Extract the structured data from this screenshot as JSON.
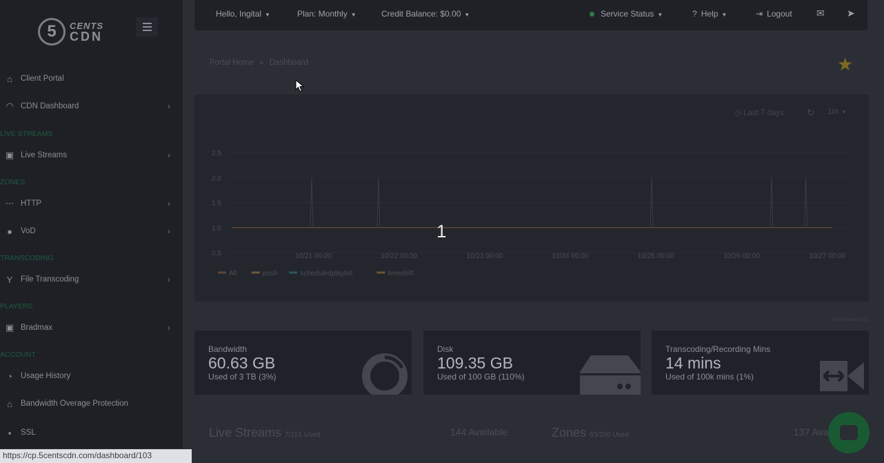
{
  "logo": {
    "mark": "5",
    "top": "CENTS",
    "bottom": "CDN"
  },
  "sidebar": {
    "items": [
      {
        "label": "Client Portal",
        "icon": "home-icon",
        "glyph": "⌂",
        "chevron": false
      },
      {
        "label": "CDN Dashboard",
        "icon": "gauge-icon",
        "glyph": "◠",
        "chevron": true
      },
      {
        "section": "LIVE STREAMS"
      },
      {
        "label": "Live Streams",
        "icon": "video-icon",
        "glyph": "▣",
        "chevron": true
      },
      {
        "section": "ZONES"
      },
      {
        "label": "HTTP",
        "icon": "http-icon",
        "glyph": "⋯",
        "chevron": true
      },
      {
        "label": "VoD",
        "icon": "play-icon",
        "glyph": "●",
        "chevron": true
      },
      {
        "section": "TRANSCODING"
      },
      {
        "label": "File Transcoding",
        "icon": "transcode-icon",
        "glyph": "Y",
        "chevron": true
      },
      {
        "section": "PLAYERS"
      },
      {
        "label": "Bradmax",
        "icon": "player-icon",
        "glyph": "▣",
        "chevron": true
      },
      {
        "section": "ACCOUNT"
      },
      {
        "label": "Usage History",
        "icon": "history-icon",
        "glyph": "◔",
        "chevron": false
      },
      {
        "label": "Bandwidth Overage Protection",
        "icon": "bank-icon",
        "glyph": "⌂",
        "chevron": false
      },
      {
        "label": "SSL",
        "icon": "lock-icon",
        "glyph": "▪",
        "chevron": false
      }
    ]
  },
  "topbar": {
    "greeting": "Hello, Ingital",
    "plan": "Plan: Monthly",
    "credit": "Credit Balance: $0.00",
    "service_status": "Service Status",
    "help": "Help",
    "logout": "Logout"
  },
  "breadcrumb": {
    "home": "Portal Home",
    "sep": "»",
    "current": "Dashboard"
  },
  "chart_controls": {
    "range": "Last 7 days",
    "interval": "1m"
  },
  "chart_data": {
    "type": "line",
    "x": [
      "10/21 00:00",
      "10/22 00:00",
      "10/23 00:00",
      "10/24 00:00",
      "10/25 00:00",
      "10/26 00:00",
      "10/27 00:00"
    ],
    "yticks": [
      0.5,
      1.0,
      1.5,
      2.0,
      2.5
    ],
    "ylim": [
      0.5,
      2.5
    ],
    "baseline": 1.0,
    "spikes_at_day": [
      0.0,
      0.78,
      3.97,
      5.37,
      5.77
    ],
    "spike_value": 2.0,
    "series": [
      {
        "name": "All",
        "color": "#5b4636"
      },
      {
        "name": "push",
        "color": "#6b5a3e"
      },
      {
        "name": "scheduledplaylist",
        "color": "#2f5560"
      },
      {
        "name": "timeshift",
        "color": "#6a5530"
      }
    ]
  },
  "overlay_number": "1",
  "footnote": "*Octoshape 2019",
  "stats": [
    {
      "title": "Bandwidth",
      "value": "60.63 GB",
      "sub": "Used of 3 TB (3%)",
      "icon": "donut-chart-icon"
    },
    {
      "title": "Disk",
      "value": "109.35 GB",
      "sub": "Used of 100 GB (110%)",
      "icon": "hard-drive-icon"
    },
    {
      "title": "Transcoding/Recording Mins",
      "value": "14 mins",
      "sub": "Used of 100k mins (1%)",
      "icon": "transcode-arrows-icon"
    }
  ],
  "live_streams": {
    "title": "Live Streams",
    "used": "7/151 Used",
    "available": "144 Available"
  },
  "zones": {
    "title": "Zones",
    "used": "63/200 Used",
    "available": "137 Ava"
  },
  "status_url": "https://cp.5centscdn.com/dashboard/103"
}
